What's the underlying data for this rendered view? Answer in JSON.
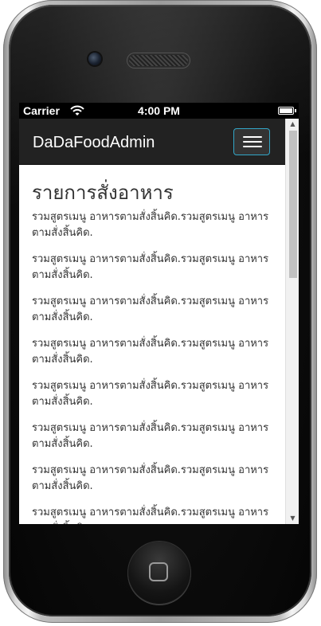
{
  "status_bar": {
    "carrier": "Carrier",
    "time": "4:00 PM"
  },
  "navbar": {
    "brand": "DaDaFoodAdmin",
    "toggle_icon": "hamburger-menu-icon",
    "toggle_border_color": "#32a6c7",
    "background_color": "#222222"
  },
  "main": {
    "title": "รายการสั่งอาหาร",
    "items": [
      {
        "text": "รวมสูตรเมนู อาหารตามสั่งสิ้นคิด.รวมสูตรเมนู อาหารตามสั่งสิ้นคิด."
      },
      {
        "text": "รวมสูตรเมนู อาหารตามสั่งสิ้นคิด.รวมสูตรเมนู อาหารตามสั่งสิ้นคิด."
      },
      {
        "text": "รวมสูตรเมนู อาหารตามสั่งสิ้นคิด.รวมสูตรเมนู อาหารตามสั่งสิ้นคิด."
      },
      {
        "text": "รวมสูตรเมนู อาหารตามสั่งสิ้นคิด.รวมสูตรเมนู อาหารตามสั่งสิ้นคิด."
      },
      {
        "text": "รวมสูตรเมนู อาหารตามสั่งสิ้นคิด.รวมสูตรเมนู อาหารตามสั่งสิ้นคิด."
      },
      {
        "text": "รวมสูตรเมนู อาหารตามสั่งสิ้นคิด.รวมสูตรเมนู อาหารตามสั่งสิ้นคิด."
      },
      {
        "text": "รวมสูตรเมนู อาหารตามสั่งสิ้นคิด.รวมสูตรเมนู อาหารตามสั่งสิ้นคิด."
      },
      {
        "text": "รวมสูตรเมนู อาหารตามสั่งสิ้นคิด.รวมสูตรเมนู อาหารตามสั่งสิ้นคิด."
      }
    ]
  },
  "device": {
    "icons": [
      "wifi-icon",
      "battery-icon",
      "camera-icon",
      "speaker-icon",
      "home-button-icon",
      "scroll-up-arrow-icon",
      "scroll-down-arrow-icon"
    ]
  }
}
